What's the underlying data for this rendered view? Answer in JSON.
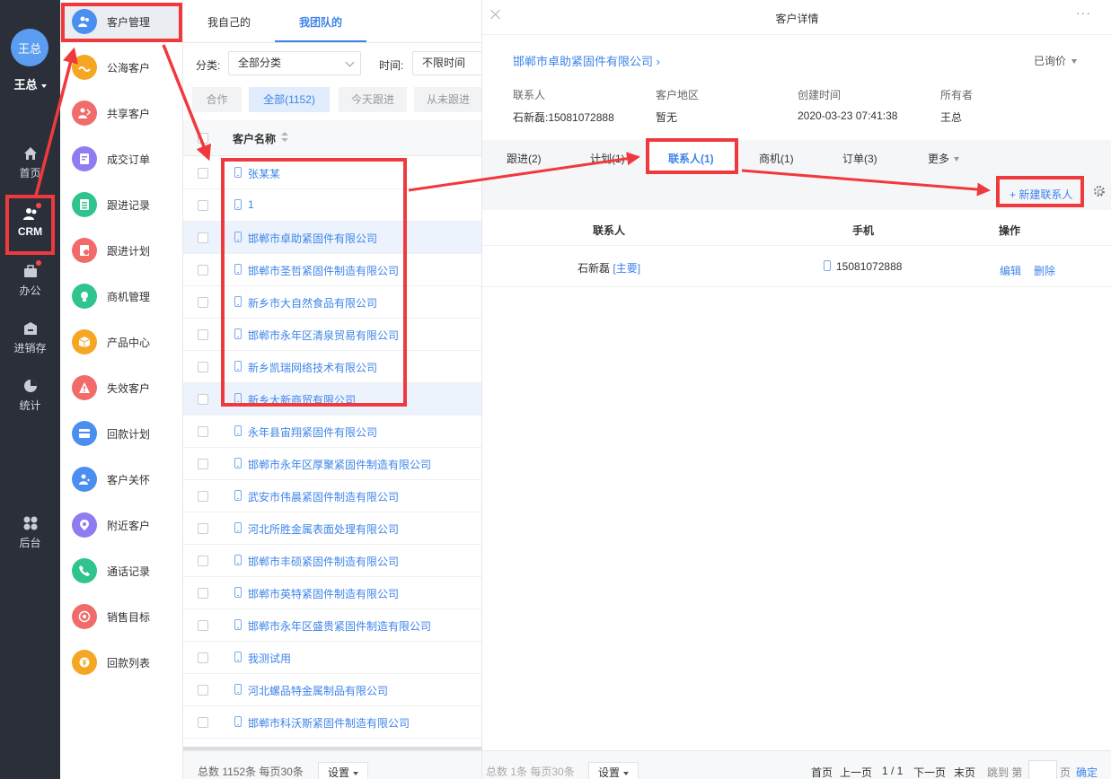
{
  "nav": {
    "avatar_text": "王总",
    "user_name": "王总",
    "items": [
      {
        "label": "首页",
        "icon": "home-icon"
      },
      {
        "label": "CRM",
        "icon": "crm-icon"
      },
      {
        "label": "办公",
        "icon": "briefcase-icon"
      },
      {
        "label": "进销存",
        "icon": "warehouse-icon"
      },
      {
        "label": "统计",
        "icon": "pie-chart-icon"
      },
      {
        "label": "后台",
        "icon": "grid-icon"
      }
    ]
  },
  "menu": {
    "items": [
      {
        "label": "客户管理",
        "icon": "customers-icon",
        "color": "#4a8ff0"
      },
      {
        "label": "公海客户",
        "icon": "sea-icon",
        "color": "#f5a623"
      },
      {
        "label": "共享客户",
        "icon": "share-icon",
        "color": "#f26b6b"
      },
      {
        "label": "成交订单",
        "icon": "order-icon",
        "color": "#8e7cf0"
      },
      {
        "label": "跟进记录",
        "icon": "record-icon",
        "color": "#2fc48d"
      },
      {
        "label": "跟进计划",
        "icon": "plan-icon",
        "color": "#f26b6b"
      },
      {
        "label": "商机管理",
        "icon": "bulb-icon",
        "color": "#2fc48d"
      },
      {
        "label": "产品中心",
        "icon": "box-icon",
        "color": "#f5a623"
      },
      {
        "label": "失效客户",
        "icon": "warning-icon",
        "color": "#f26b6b"
      },
      {
        "label": "回款计划",
        "icon": "payment-plan-icon",
        "color": "#4a8ff0"
      },
      {
        "label": "客户关怀",
        "icon": "care-icon",
        "color": "#4a8ff0"
      },
      {
        "label": "附近客户",
        "icon": "location-icon",
        "color": "#8e7cf0"
      },
      {
        "label": "通话记录",
        "icon": "phone-call-icon",
        "color": "#2fc48d"
      },
      {
        "label": "销售目标",
        "icon": "target-icon",
        "color": "#f26b6b"
      },
      {
        "label": "回款列表",
        "icon": "payment-list-icon",
        "color": "#f5a623"
      }
    ]
  },
  "list": {
    "tabs": [
      "我自己的",
      "我团队的"
    ],
    "filter_category_label": "分类:",
    "filter_category_value": "全部分类",
    "filter_time_label": "时间:",
    "filter_time_value": "不限时间",
    "quick_filters": [
      "合作",
      "全部(1152)",
      "今天跟进",
      "从未跟进"
    ],
    "column_header": "客户名称",
    "rows": [
      "张某某",
      "1",
      "邯郸市卓助紧固件有限公司",
      "邯郸市圣哲紧固件制造有限公司",
      "新乡市大自然食品有限公司",
      "邯郸市永年区清泉贸易有限公司",
      "新乡凯瑞网络技术有限公司",
      "新乡大新商贸有限公司",
      "永年县宙翔紧固件有限公司",
      "邯郸市永年区厚聚紧固件制造有限公司",
      "武安市伟晨紧固件制造有限公司",
      "河北所胜金属表面处理有限公司",
      "邯郸市丰硕紧固件制造有限公司",
      "邯郸市英特紧固件制造有限公司",
      "邯郸市永年区盛贵紧固件制造有限公司",
      "我测试用",
      "河北螺品特金属制品有限公司",
      "邯郸市科沃斯紧固件制造有限公司"
    ],
    "footer_text": "总数 1152条 每页30条",
    "settings_label": "设置"
  },
  "detail": {
    "title": "客户详情",
    "more": "···",
    "company": "邯郸市卓助紧固件有限公司 ›",
    "status": "已询价",
    "fields": [
      {
        "label": "联系人",
        "value": "石新磊:15081072888"
      },
      {
        "label": "客户地区",
        "value": "暂无"
      },
      {
        "label": "创建时间",
        "value": "2020-03-23 07:41:38"
      },
      {
        "label": "所有者",
        "value": "王总"
      }
    ],
    "tabs": [
      "跟进(2)",
      "计划(1)",
      "联系人(1)",
      "商机(1)",
      "订单(3)",
      "更多"
    ],
    "add_contact": "+ 新建联系人",
    "contacts_headers": [
      "联系人",
      "手机",
      "操作"
    ],
    "contact": {
      "name": "石新磊",
      "tag": "[主要]",
      "phone": "15081072888",
      "edit": "编辑",
      "delete": "删除"
    },
    "footer_text": "总数 1条 每页30条",
    "settings_label": "设置",
    "pager": {
      "first": "首页",
      "prev": "上一页",
      "page": "1 / 1",
      "next": "下一页",
      "last": "末页",
      "jump_prefix": "跳到 第",
      "jump_suffix": "页",
      "confirm": "确定"
    }
  },
  "colors": {
    "accent": "#3e84e9",
    "annotation": "#f0393d",
    "nav_bg": "#2b2f3a"
  }
}
